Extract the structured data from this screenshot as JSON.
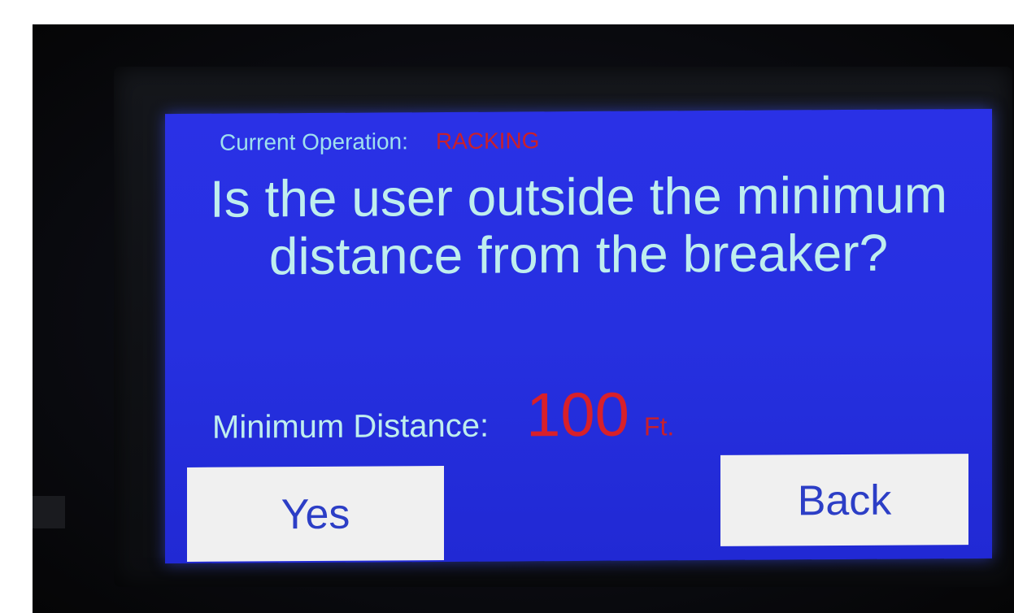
{
  "screen": {
    "operation_label": "Current Operation:",
    "operation_value": "RACKING",
    "question": "Is the user outside the minimum distance from the breaker?",
    "min_distance_label": "Minimum Distance:",
    "min_distance_value": "100",
    "min_distance_unit": "Ft."
  },
  "buttons": {
    "yes_label": "Yes",
    "back_label": "Back"
  },
  "colors": {
    "screen_background": "#2630e0",
    "text_primary": "#bfeeee",
    "text_accent_red": "#d8202a",
    "button_background": "#f0f0f0",
    "button_text": "#2c3ec6"
  }
}
